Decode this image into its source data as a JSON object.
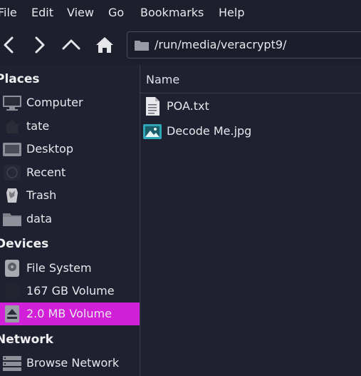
{
  "menubar": {
    "items": [
      {
        "label": "File"
      },
      {
        "label": "Edit"
      },
      {
        "label": "View"
      },
      {
        "label": "Go"
      },
      {
        "label": "Bookmarks"
      },
      {
        "label": "Help"
      }
    ]
  },
  "toolbar": {
    "path": "/run/media/veracrypt9/",
    "buttons": [
      "back-icon",
      "forward-icon",
      "up-icon",
      "home-icon"
    ]
  },
  "sidebar": {
    "places_header": "Places",
    "places": [
      {
        "label": "Computer",
        "icon": "computer-icon"
      },
      {
        "label": "tate",
        "icon": "home-folder-icon"
      },
      {
        "label": "Desktop",
        "icon": "desktop-icon"
      },
      {
        "label": "Recent",
        "icon": "recent-icon"
      },
      {
        "label": "Trash",
        "icon": "trash-icon"
      },
      {
        "label": "data",
        "icon": "folder-icon"
      }
    ],
    "devices_header": "Devices",
    "devices": [
      {
        "label": "File System",
        "icon": "drive-icon"
      },
      {
        "label": "167 GB Volume",
        "icon": "drive-icon"
      },
      {
        "label": "2.0 MB Volume",
        "icon": "eject-icon",
        "selected": true
      }
    ],
    "network_header": "Network",
    "network": [
      {
        "label": "Browse Network",
        "icon": "network-icon"
      }
    ]
  },
  "main": {
    "column_name": "Name",
    "files": [
      {
        "name": "POA.txt",
        "icon": "text-file-icon"
      },
      {
        "name": "Decode Me.jpg",
        "icon": "image-file-icon"
      }
    ]
  },
  "colors": {
    "background": "#1f2130",
    "selection": "#d21fd8",
    "text": "#e8e8ec"
  }
}
